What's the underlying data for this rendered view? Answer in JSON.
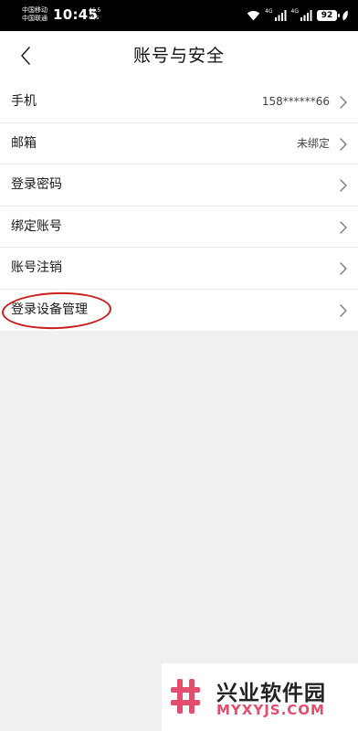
{
  "status_bar": {
    "carrier_1": "中国移动",
    "carrier_2": "中国联通",
    "time": "10:45",
    "speed_value": "46.5",
    "speed_unit": "K/s",
    "net_1": "4G",
    "net_2": "4G",
    "battery": "92"
  },
  "header": {
    "title": "账号与安全"
  },
  "rows": [
    {
      "label": "手机",
      "value": "158******66"
    },
    {
      "label": "邮箱",
      "value": "未绑定"
    },
    {
      "label": "登录密码",
      "value": ""
    },
    {
      "label": "绑定账号",
      "value": ""
    },
    {
      "label": "账号注销",
      "value": ""
    },
    {
      "label": "登录设备管理",
      "value": ""
    }
  ],
  "watermark": {
    "name": "兴业软件园",
    "url": "MYXYJS.COM"
  },
  "colors": {
    "annotation": "#c8201b",
    "watermark_accent": "#e44d6e"
  }
}
